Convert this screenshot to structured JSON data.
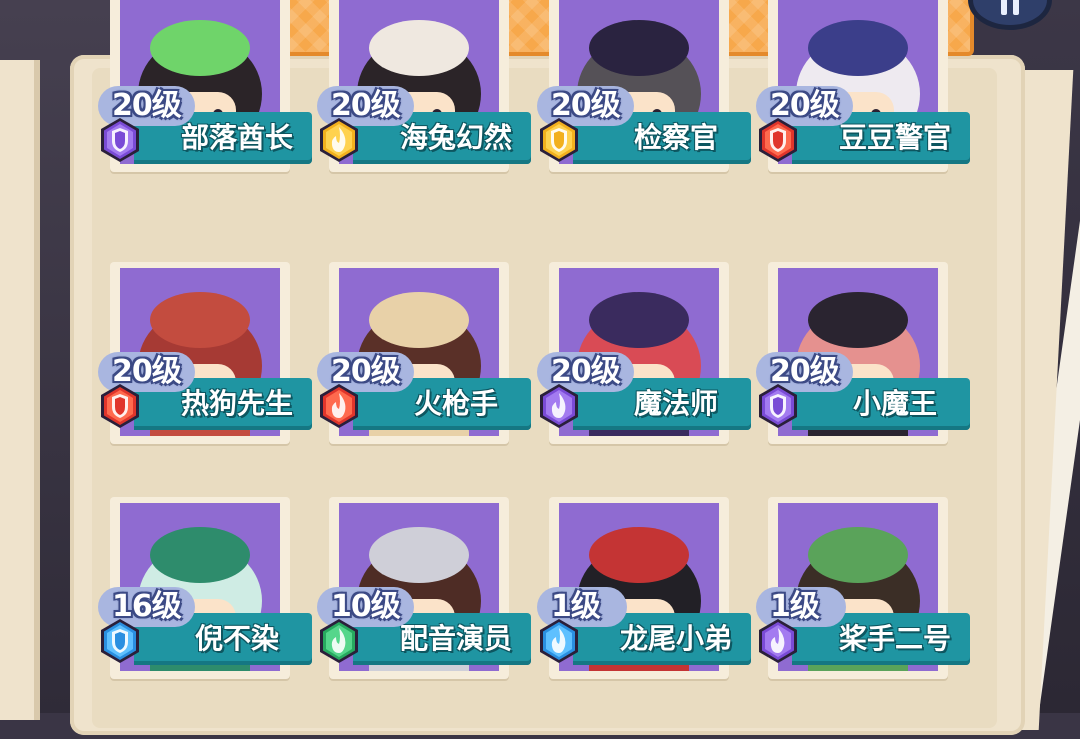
{
  "top_banner": {},
  "pause_button": {
    "icon": "pause-icon"
  },
  "characters": [
    {
      "level": "20级",
      "name": "部落酋长",
      "badge_color": "#7a4bd6",
      "badge_inner": "#a37bf0",
      "badge_icon": "shield-icon",
      "theme": "#2b2428",
      "accent": "#6fd46a"
    },
    {
      "level": "20级",
      "name": "海兔幻然",
      "badge_color": "#f2b01e",
      "badge_inner": "#ffd24f",
      "badge_icon": "flame-icon",
      "theme": "#2b2428",
      "accent": "#efe8e0"
    },
    {
      "level": "20级",
      "name": "检察官",
      "badge_color": "#f2b01e",
      "badge_inner": "#ffd24f",
      "badge_icon": "shield-icon",
      "theme": "#555157",
      "accent": "#2a2340"
    },
    {
      "level": "20级",
      "name": "豆豆警官",
      "badge_color": "#e0352b",
      "badge_inner": "#ff6a4e",
      "badge_icon": "shield-icon",
      "theme": "#eeeaf0",
      "accent": "#3b3e8a"
    },
    {
      "level": "20级",
      "name": "热狗先生",
      "badge_color": "#e0352b",
      "badge_inner": "#ff6a4e",
      "badge_icon": "shield-icon",
      "theme": "#a63a34",
      "accent": "#c34c3f"
    },
    {
      "level": "20级",
      "name": "火枪手",
      "badge_color": "#e0352b",
      "badge_inner": "#ff6a4e",
      "badge_icon": "flame-icon",
      "theme": "#5a3028",
      "accent": "#e8d1a8"
    },
    {
      "level": "20级",
      "name": "魔法师",
      "badge_color": "#7a4bd6",
      "badge_inner": "#a37bf0",
      "badge_icon": "flame-icon",
      "theme": "#d94b55",
      "accent": "#3a2b5e"
    },
    {
      "level": "20级",
      "name": "小魔王",
      "badge_color": "#7a4bd6",
      "badge_inner": "#a37bf0",
      "badge_icon": "shield-icon",
      "theme": "#e5918f",
      "accent": "#2a2430"
    },
    {
      "level": "16级",
      "name": "倪不染",
      "badge_color": "#2a8fe0",
      "badge_inner": "#5ec0ff",
      "badge_icon": "shield-icon",
      "theme": "#cfece4",
      "accent": "#2e8c6c"
    },
    {
      "level": "10级",
      "name": "配音演员",
      "badge_color": "#27a95f",
      "badge_inner": "#55d68b",
      "badge_icon": "flame-icon",
      "theme": "#4e2c25",
      "accent": "#cfcfd8"
    },
    {
      "level": "1级",
      "name": "龙尾小弟",
      "badge_color": "#2a8fe0",
      "badge_inner": "#5ec0ff",
      "badge_icon": "flame-icon",
      "theme": "#222026",
      "accent": "#c43434"
    },
    {
      "level": "1级",
      "name": "桨手二号",
      "badge_color": "#7a4bd6",
      "badge_inner": "#a37bf0",
      "badge_icon": "flame-icon",
      "theme": "#3b2e26",
      "accent": "#5aa35a"
    }
  ]
}
